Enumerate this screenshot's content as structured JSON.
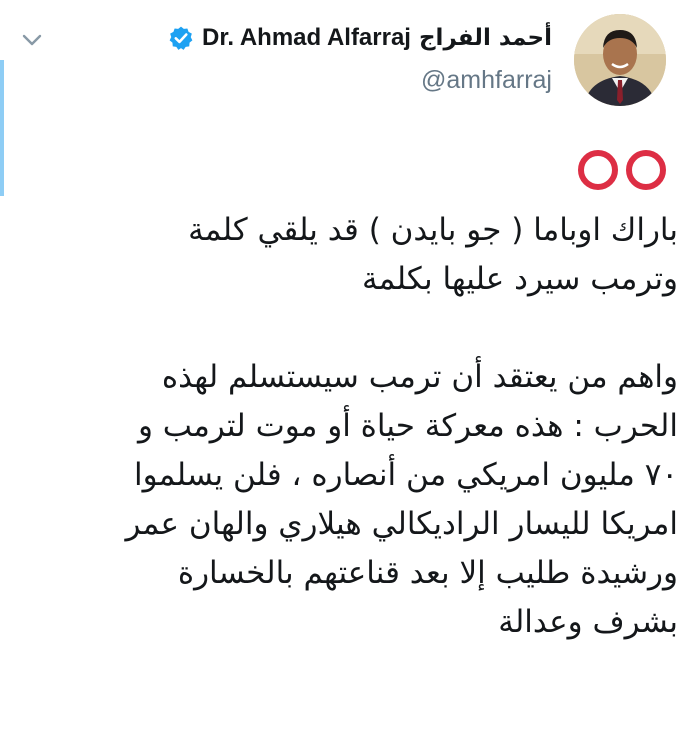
{
  "tweet": {
    "author_display_name_ar": "أحمد الفراج",
    "author_display_name_en": "Dr. Ahmad Alfarraj",
    "author_handle": "@amhfarraj",
    "verified": true,
    "emoji_icon": "hollow-red-circle-icon x2",
    "paragraph_1": [
      "باراك اوباما ( جو بايدن ) قد يلقي كلمة",
      "وترمب سيرد عليها بكلمة"
    ],
    "paragraph_2": [
      "واهم من يعتقد أن ترمب سيستسلم لهذه",
      "الحرب : هذه معركة حياة أو موت لترمب و",
      "٧٠ مليون امريكي من أنصاره ، فلن يسلموا",
      "امريكا لليسار الراديكالي هيلاري والهان عمر",
      "ورشيدة طليب إلا بعد قناعتهم بالخسارة",
      "بشرف وعدالة"
    ]
  },
  "colors": {
    "text": "#14171a",
    "secondary": "#657786",
    "verified_blue": "#1da1f2",
    "circle_red": "#dd2e44",
    "accent_rule": "#8ecdf5"
  }
}
